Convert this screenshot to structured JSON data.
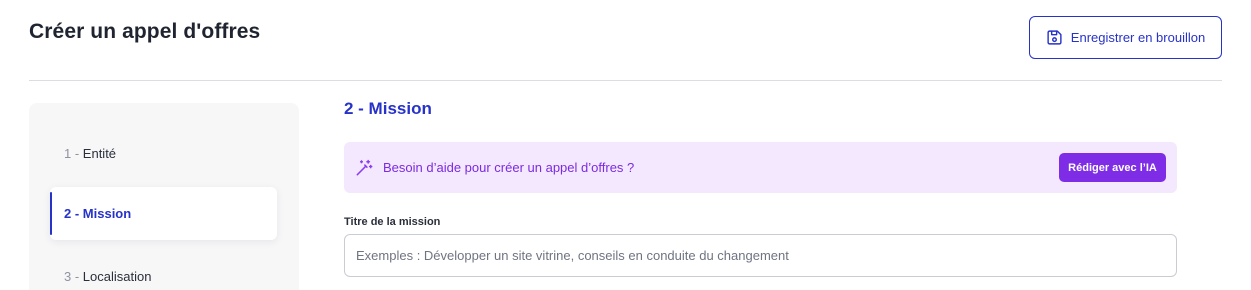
{
  "header": {
    "title": "Créer un appel d'offres",
    "draft_button_label": "Enregistrer en brouillon",
    "draft_button_icon": "save-icon"
  },
  "stepper": {
    "steps": [
      {
        "number": "1",
        "label": "Entité",
        "active": false
      },
      {
        "number": "2",
        "label": "Mission",
        "active": true
      },
      {
        "number": "3",
        "label": "Localisation",
        "active": false
      }
    ],
    "separator": " - "
  },
  "section": {
    "title": "2 - Mission"
  },
  "ai_banner": {
    "icon": "magic-wand-icon",
    "text": "Besoin d’aide pour créer un appel d’offres ?",
    "button_label": "Rédiger avec l’IA"
  },
  "mission_title_field": {
    "label": "Titre de la mission",
    "value": "",
    "placeholder": "Exemples : Développer un site vitrine, conseils en conduite du changement"
  },
  "colors": {
    "primary": "#2732c9",
    "ai_accent": "#7e2ce6",
    "ai_banner_bg": "#f3e8fd",
    "stepper_bg": "#f7f7f8"
  }
}
